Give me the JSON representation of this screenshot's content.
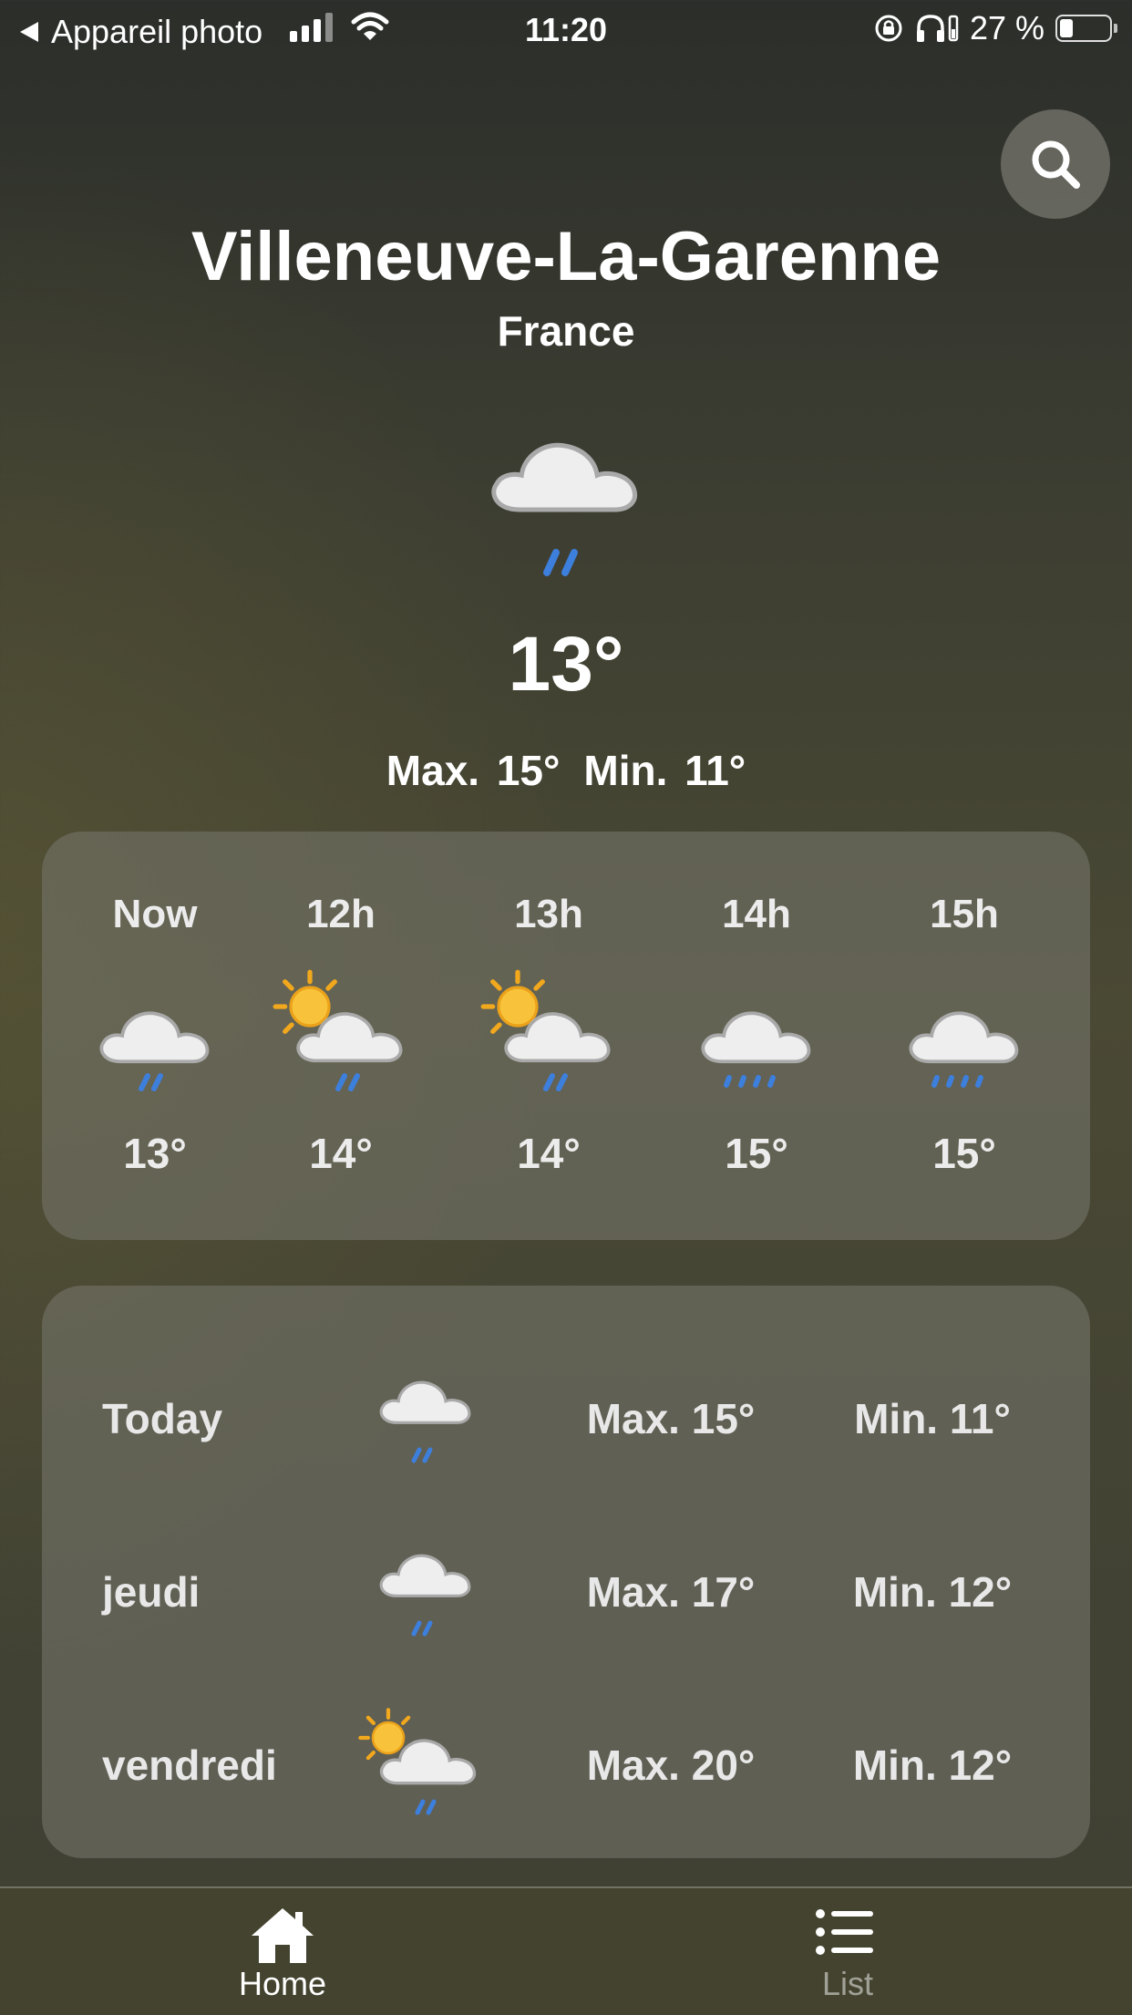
{
  "status_bar": {
    "back_label": "Appareil photo",
    "time": "11:20",
    "battery": "27 %",
    "battery_level": 0.27
  },
  "location": {
    "city": "Villeneuve-La-Garenne",
    "country": "France"
  },
  "current": {
    "icon": "cloud-rain-icon",
    "temperature": "13°",
    "max": "Max. 15°",
    "min": "Min. 11°"
  },
  "hourly": [
    {
      "label": "Now",
      "temp": "13°",
      "icon": "cloud-rain-icon"
    },
    {
      "label": "12h",
      "temp": "14°",
      "icon": "sun-cloud-rain-icon"
    },
    {
      "label": "13h",
      "temp": "14°",
      "icon": "sun-cloud-rain-icon"
    },
    {
      "label": "14h",
      "temp": "15°",
      "icon": "cloud-drizzle-icon"
    },
    {
      "label": "15h",
      "temp": "15°",
      "icon": "cloud-drizzle-icon"
    }
  ],
  "daily": [
    {
      "day": "Today",
      "max": "Max. 15°",
      "min": "Min. 11°",
      "icon": "cloud-rain-icon"
    },
    {
      "day": "jeudi",
      "max": "Max. 17°",
      "min": "Min. 12°",
      "icon": "cloud-rain-icon"
    },
    {
      "day": "vendredi",
      "max": "Max. 20°",
      "min": "Min. 12°",
      "icon": "sun-cloud-rain-icon"
    }
  ],
  "tabs": [
    {
      "label": "Home",
      "icon": "home-icon",
      "active": true
    },
    {
      "label": "List",
      "icon": "list-icon",
      "active": false
    }
  ],
  "colors": {
    "rain": "#3d7fdc",
    "sun": "#f5b92e",
    "cloud": "#efefef"
  }
}
